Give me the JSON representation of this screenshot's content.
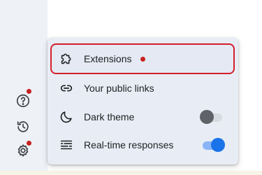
{
  "sidebar": {
    "icons": [
      {
        "name": "help-icon",
        "badge": true
      },
      {
        "name": "history-icon",
        "badge": false
      },
      {
        "name": "settings-icon",
        "badge": true
      }
    ]
  },
  "menu": {
    "items": [
      {
        "label": "Extensions",
        "icon": "puzzle-piece-icon",
        "badge": true,
        "highlighted": true
      },
      {
        "label": "Your public links",
        "icon": "link-icon"
      },
      {
        "label": "Dark theme",
        "icon": "crescent-moon-icon",
        "toggle": false
      },
      {
        "label": "Real-time responses",
        "icon": "realtime-lines-icon",
        "toggle": true
      }
    ]
  },
  "colors": {
    "badge": "#c5221f",
    "highlight_border": "#d41f2c",
    "toggle_on": "#1a73e8",
    "toggle_on_track": "#8ab4f8",
    "toggle_off_knob": "#5f6368",
    "menu_background": "#e8edf5"
  }
}
